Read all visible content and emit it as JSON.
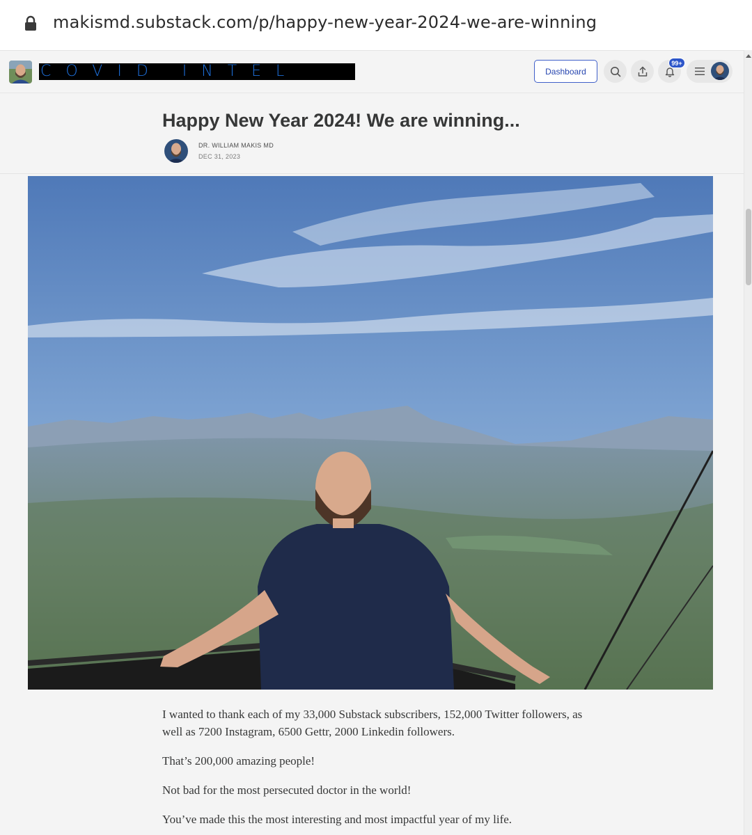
{
  "browser": {
    "url": "makismd.substack.com/p/happy-new-year-2024-we-are-winning"
  },
  "header": {
    "publication_logo_text": "COVID INTEL",
    "dashboard_label": "Dashboard",
    "notification_badge": "99+"
  },
  "post": {
    "title": "Happy New Year 2024! We are winning...",
    "author": "DR. WILLIAM MAKIS MD",
    "date": "DEC 31, 2023",
    "paragraphs": [
      "I wanted to thank each of my 33,000 Substack subscribers, 152,000 Twitter followers, as well as 7200 Instagram, 6500 Gettr, 2000 Linkedin followers.",
      "That’s 200,000 amazing people!",
      "Not bad for the most persecuted doctor in the world!",
      "You’ve made this the most interesting and most impactful year of my life."
    ]
  },
  "icons": [
    "lock-icon",
    "search-icon",
    "share-icon",
    "bell-icon",
    "menu-icon"
  ],
  "colors": {
    "accent": "#2746b0",
    "badge": "#2c55c9",
    "logo_text": "#1e6fd9",
    "logo_bg": "#000000"
  }
}
